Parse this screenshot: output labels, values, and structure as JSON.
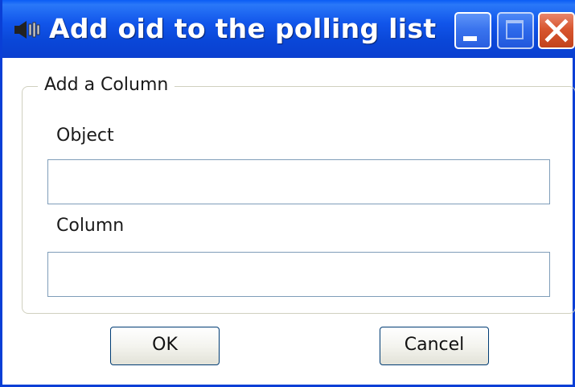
{
  "window": {
    "title": "Add oid to the polling list",
    "controls": {
      "minimize_icon": "minimize-icon",
      "maximize_icon": "maximize-icon",
      "close_icon": "close-icon"
    },
    "title_icon": "speaker-icon"
  },
  "group": {
    "title": "Add a Column",
    "fields": {
      "object_label": "Object",
      "object_value": "",
      "column_label": "Column",
      "column_value": ""
    }
  },
  "buttons": {
    "ok_label": "OK",
    "cancel_label": "Cancel"
  },
  "colors": {
    "titlebar": "#0a47d8",
    "close_button": "#d8562f",
    "field_border": "#7f9db9",
    "button_border": "#003c74"
  }
}
